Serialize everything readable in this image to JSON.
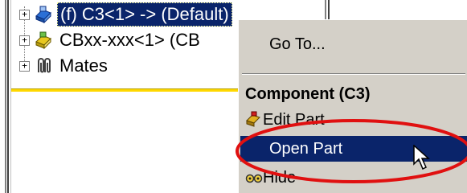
{
  "tree": {
    "rows": [
      {
        "label": "(f) C3<1> -> (Default)",
        "expander": "+",
        "icon": "blue-part-component-icon"
      },
      {
        "label": "CBxx-xxx<1> (CB",
        "expander": "+",
        "icon": "yellow-part-component-icon"
      },
      {
        "label": "Mates",
        "expander": "+",
        "icon": "mates-paperclip-icon"
      }
    ]
  },
  "context_menu": {
    "goto_label": "Go To...",
    "section_header": "Component (C3)",
    "items": [
      {
        "label": "Edit Part",
        "icon": "edit-part-icon"
      },
      {
        "label": "Open Part",
        "icon": ""
      },
      {
        "label": "Hide",
        "icon": "hide-glasses-icon"
      }
    ]
  },
  "colors": {
    "selection": "#0a246a",
    "menu_bg": "#d4d0c8",
    "rollback_bar": "#ffd800",
    "annotation_ellipse": "#e01010"
  }
}
